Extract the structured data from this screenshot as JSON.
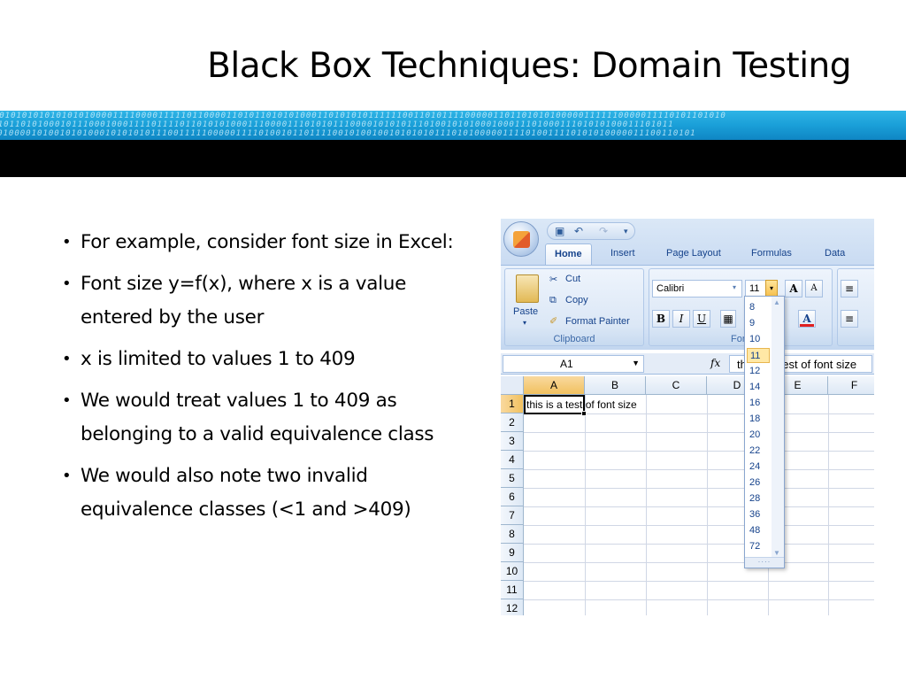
{
  "slide": {
    "title": "Black Box Techniques: Domain Testing",
    "bullets": [
      "For example, consider font size in Excel:",
      "Font size y=f(x), where x is a value entered by the user",
      "x is limited to values 1 to 409",
      "We would treat values 1 to 409 as belonging to a valid equivalence class",
      "We would also note two invalid equivalence classes (<1 and >409)"
    ],
    "bullet_char": "•"
  },
  "excel": {
    "tabs": [
      "Home",
      "Insert",
      "Page Layout",
      "Formulas",
      "Data"
    ],
    "active_tab": "Home",
    "clipboard": {
      "paste": "Paste",
      "cut": "Cut",
      "copy": "Copy",
      "format_painter": "Format Painter",
      "label": "Clipboard"
    },
    "font": {
      "family": "Calibri",
      "size": "11",
      "label": "Font",
      "bold": "B",
      "italic": "I",
      "underline": "U",
      "grow": "A",
      "shrink": "A",
      "color": "A"
    },
    "formula_bar": {
      "name_box": "A1",
      "fx": "fx",
      "value": "this is a test of font size"
    },
    "columns": [
      "A",
      "B",
      "C",
      "D",
      "E",
      "F"
    ],
    "rows": [
      "1",
      "2",
      "3",
      "4",
      "5",
      "6",
      "7",
      "8",
      "9",
      "10",
      "11",
      "12"
    ],
    "cell_a1": "this is a test of font size",
    "font_size_options": [
      "8",
      "9",
      "10",
      "11",
      "12",
      "14",
      "16",
      "18",
      "20",
      "22",
      "24",
      "26",
      "28",
      "36",
      "48",
      "72"
    ],
    "highlighted_option": "11",
    "colors": {
      "ribbon": "#dbe8f7",
      "selection_header": "#f1c15f",
      "highlight": "#ffe8a6",
      "text_blue": "#15428b",
      "font_color_bar": "#e02020"
    }
  }
}
